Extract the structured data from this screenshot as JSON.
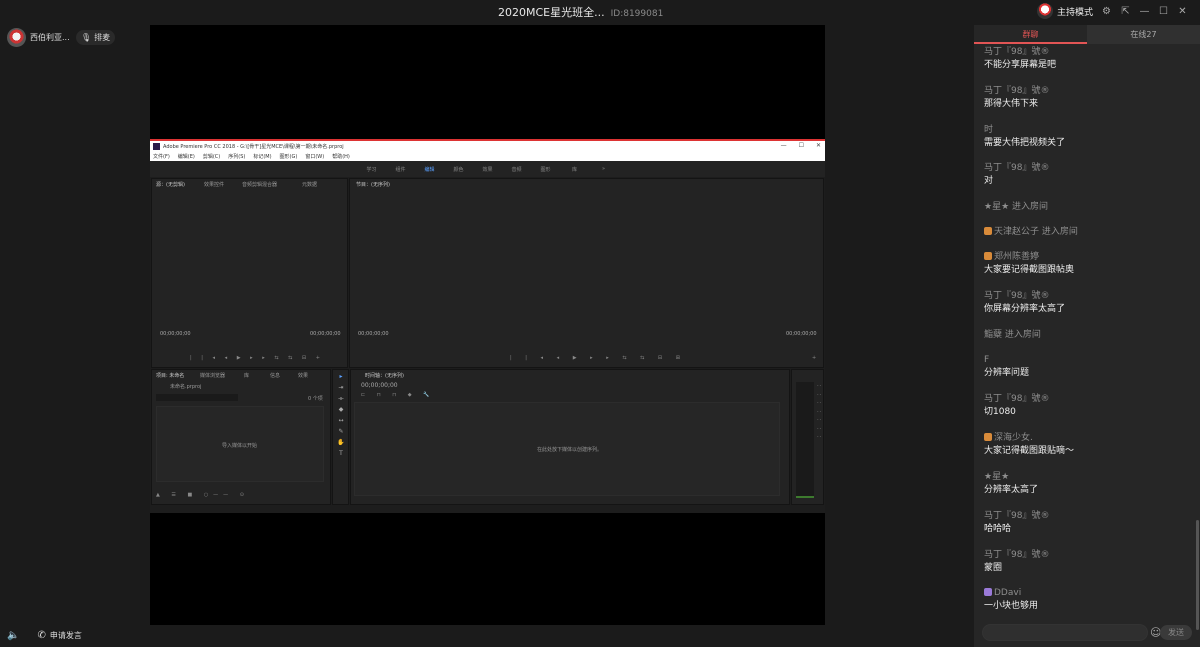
{
  "window": {
    "title": "2020MCE星光班全...",
    "room_id": "ID:8199081"
  },
  "header": {
    "mode_label": "主持模式"
  },
  "teacher": {
    "name": "西伯利亚..."
  },
  "mic": {
    "label": "排麦"
  },
  "premiere": {
    "title": "Adobe Premiere Pro CC 2018 - G:\\[骨干]星光MCE\\课程\\第一期\\未命名.prproj",
    "menu": [
      "文件(F)",
      "编辑(E)",
      "剪辑(C)",
      "序列(S)",
      "标记(M)",
      "图形(G)",
      "窗口(W)",
      "帮助(H)"
    ],
    "workspaces": [
      "学习",
      "组件",
      "编辑",
      "颜色",
      "效果",
      "音频",
      "图形",
      "库",
      "»"
    ],
    "source_tabs": [
      "源：(无剪辑)",
      "效果控件",
      "音频剪辑混合器",
      "元数据"
    ],
    "program_tab": "节目：(无序列)",
    "timecode": "00;00;00;00",
    "project_tabs": [
      "项目: 未命名",
      "媒体浏览器",
      "库",
      "信息",
      "效果"
    ],
    "project_file": "未命名.prproj",
    "items_count": "0 个项",
    "import_hint": "导入媒体以开始",
    "timeline_tab": "时间轴：(无序列)",
    "timeline_hint": "在此处放下媒体以创建序列。"
  },
  "bottom": {
    "apply_label": "申请发言"
  },
  "chat": {
    "tabs": [
      "群聊",
      "在线27"
    ],
    "messages": [
      {
        "name": "马丁『98』號®",
        "text": "不能分享屏幕是吧"
      },
      {
        "name": "马丁『98』號®",
        "text": "那得大伟下来"
      },
      {
        "name": "时",
        "text": "需要大伟把视频关了"
      },
      {
        "name": "马丁『98』號®",
        "text": "对"
      },
      {
        "name": "★星★ 进入房间",
        "text": ""
      },
      {
        "name": "天津赵公子 进入房间",
        "text": "",
        "badge": "orange"
      },
      {
        "name": "郑州陈善婷",
        "text": "大家要记得截图跟帖奥",
        "badge": "orange"
      },
      {
        "name": "马丁『98』號®",
        "text": "你屏幕分辨率太高了"
      },
      {
        "name": "鮨糵 进入房间",
        "text": ""
      },
      {
        "name": "F",
        "text": "分辨率问题"
      },
      {
        "name": "马丁『98』號®",
        "text": "切1080"
      },
      {
        "name": "深海少女.",
        "text": "大家记得截图跟贴嘀～",
        "badge": "orange"
      },
      {
        "name": "★星★",
        "text": "分辨率太高了"
      },
      {
        "name": "马丁『98』號®",
        "text": "哈哈哈"
      },
      {
        "name": "马丁『98』號®",
        "text": "蒙圈"
      },
      {
        "name": "DDavi",
        "text": "一小块也够用",
        "badge": "purple"
      }
    ],
    "input_placeholder": "",
    "send_label": "发送"
  }
}
